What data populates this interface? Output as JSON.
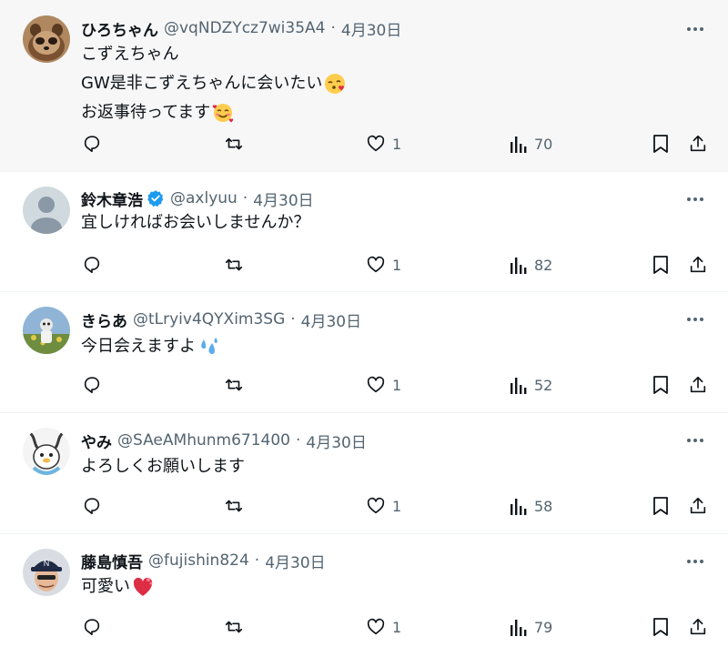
{
  "tweets": [
    {
      "name": "ひろちゃん",
      "handle": "@vqNDZYcz7wi35A4",
      "separator": "·",
      "date": "4月30日",
      "verified": false,
      "lines": [
        "こずえちゃん",
        "GW是非こずえちゃんに会いたい",
        "お返事待ってます"
      ],
      "line_emojis": [
        "",
        "kissing-face-with-heart-emoji",
        "smiling-face-with-hearts-emoji"
      ],
      "likes": "1",
      "views": "70",
      "avatar_icon": "tanuki-avatar"
    },
    {
      "name": "鈴木章浩",
      "handle": "@axlyuu",
      "separator": "·",
      "date": "4月30日",
      "verified": true,
      "lines": [
        "宜しければお会いしませんか？"
      ],
      "likes": "1",
      "views": "82",
      "avatar_icon": "default-avatar"
    },
    {
      "name": "きらあ",
      "handle": "@tLryiv4QYXim3SG",
      "separator": "·",
      "date": "4月30日",
      "verified": false,
      "lines": [
        "今日会えますよ"
      ],
      "line_emojis": [
        "sweat-droplets-emoji"
      ],
      "likes": "1",
      "views": "52",
      "avatar_icon": "field-photo-avatar"
    },
    {
      "name": "やみ",
      "handle": "@SAeAMhunm671400",
      "separator": "·",
      "date": "4月30日",
      "verified": false,
      "lines": [
        "よろしくお願いします"
      ],
      "likes": "1",
      "views": "58",
      "avatar_icon": "illustration-avatar"
    },
    {
      "name": "藤島慎吾",
      "handle": "@fujishin824",
      "separator": "·",
      "date": "4月30日",
      "verified": false,
      "lines": [
        "可愛い"
      ],
      "line_emojis": [
        "heart-exclamation-emoji"
      ],
      "likes": "1",
      "views": "79",
      "avatar_icon": "cap-man-avatar"
    }
  ],
  "colors": {
    "text": "#0f1419",
    "muted": "#536471",
    "verified": "#1d9bf0",
    "highlight_bg": "#f7f7f7",
    "divider": "#eff3f4"
  }
}
